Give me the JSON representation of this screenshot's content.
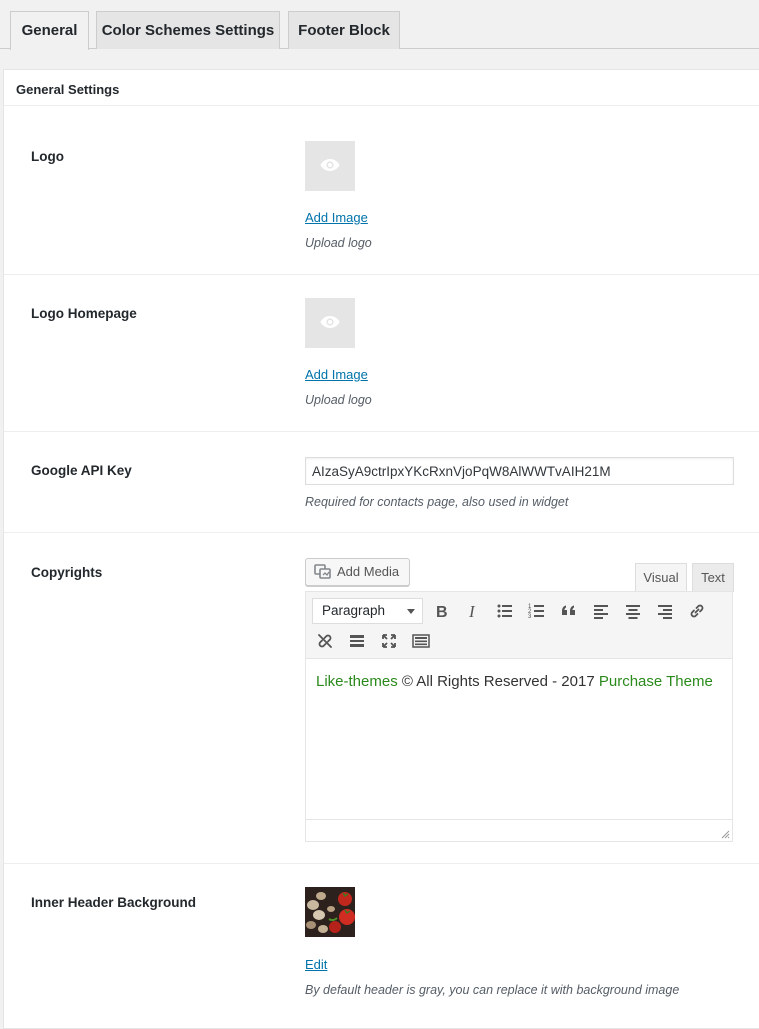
{
  "tabs": [
    {
      "label": "General"
    },
    {
      "label": "Color Schemes Settings"
    },
    {
      "label": "Footer Block"
    }
  ],
  "panel": {
    "title": "General Settings"
  },
  "logo": {
    "label": "Logo",
    "link": "Add Image",
    "description": "Upload logo"
  },
  "logo_homepage": {
    "label": "Logo Homepage",
    "link": "Add Image",
    "description": "Upload logo"
  },
  "api_key": {
    "label": "Google API Key",
    "value": "AIzaSyA9ctrIpxYKcRxnVjoPqW8AlWWTvAIH21M",
    "description": "Required for contacts page, also used in widget"
  },
  "copyrights": {
    "label": "Copyrights",
    "add_media": "Add Media",
    "tab_visual": "Visual",
    "tab_text": "Text",
    "format": "Paragraph",
    "content": {
      "link1": "Like-themes",
      "middle": " © All Rights Reserved - 2017 ",
      "link2": "Purchase Theme"
    },
    "link_color": "#2b8a1c"
  },
  "inner_header": {
    "label": "Inner Header Background",
    "link": "Edit",
    "description": "By default header is gray, you can replace it with background image"
  },
  "colors": {
    "link": "#0073aa",
    "accent_green": "#2b8a1c"
  }
}
